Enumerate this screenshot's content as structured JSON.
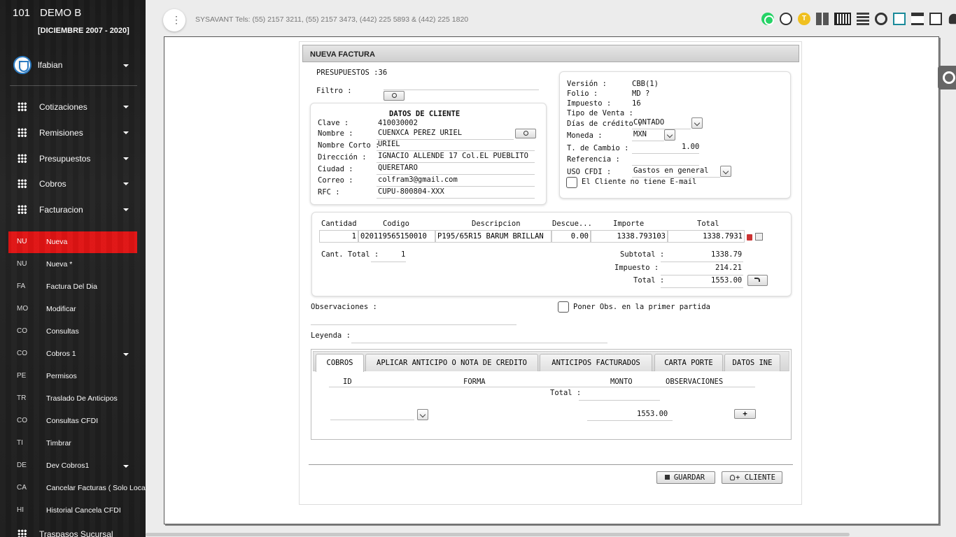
{
  "sidebar": {
    "company_num": "101",
    "company_name": "DEMO B",
    "period": "[DICIEMBRE 2007 - 2020]",
    "username": "lfabian",
    "menus": [
      {
        "label": "Cotizaciones"
      },
      {
        "label": "Remisiones"
      },
      {
        "label": "Presupuestos"
      },
      {
        "label": "Cobros"
      },
      {
        "label": "Facturacion"
      }
    ],
    "items": [
      {
        "abbr": "NU",
        "label": "Nueva"
      },
      {
        "abbr": "NU",
        "label": "Nueva *"
      },
      {
        "abbr": "FA",
        "label": "Factura Del Dia"
      },
      {
        "abbr": "MO",
        "label": "Modificar"
      },
      {
        "abbr": "CO",
        "label": "Consultas"
      },
      {
        "abbr": "CO",
        "label": "Cobros 1"
      },
      {
        "abbr": "PE",
        "label": "Permisos"
      },
      {
        "abbr": "TR",
        "label": "Traslado De Anticipos"
      },
      {
        "abbr": "CO",
        "label": "Consultas CFDI"
      },
      {
        "abbr": "TI",
        "label": "Timbrar"
      },
      {
        "abbr": "DE",
        "label": "Dev Cobros1"
      },
      {
        "abbr": "CA",
        "label": "Cancelar Facturas ( Solo Local"
      },
      {
        "abbr": "HI",
        "label": "Historial Cancela CFDI"
      }
    ],
    "last_menu": "Traspasos Sucursal"
  },
  "topbar": {
    "info": "SYSAVANT Tels: (55) 2157 3211, (55) 2157 3473, (442) 225 5893 & (442) 225 1820",
    "t_icon": "T"
  },
  "form": {
    "title": "NUEVA FACTURA",
    "presupuestos": "PRESUPUESTOS :36",
    "filtro_label": "Filtro :",
    "cliente": {
      "title": "DATOS DE CLIENTE",
      "labels": [
        "Clave :",
        "Nombre :",
        "Nombre Corto :",
        "Dirección :",
        "Ciudad :",
        "Correo :",
        "RFC :"
      ],
      "values": [
        "410030002",
        "CUENXCA PEREZ URIEL",
        "URIEL",
        "IGNACIO ALLENDE 17 Col.EL PUEBLITO",
        "QUERETARO",
        "colfram3@gmail.com",
        "CUPU-800804-XXX"
      ]
    },
    "info": {
      "labels": [
        "Versión :",
        "Folio :",
        "Impuesto :",
        "Tipo de Venta :",
        "Días de crédito :",
        "Moneda :",
        "T. de Cambio :",
        "Referencia :",
        "USO CFDI :"
      ],
      "version": "CBB(1)",
      "folio": "MD ?",
      "impuesto": "16",
      "dias_credito": "CONTADO",
      "moneda": "MXN",
      "tipo_cambio": "1.00",
      "uso_cfdi": "Gastos en general",
      "no_email": "El Cliente no tiene E-mail"
    },
    "items": {
      "headers": [
        "Cantidad",
        "Codigo",
        "Descripcion",
        "Descue...",
        "Importe",
        "Total"
      ],
      "rows": [
        {
          "cantidad": "1",
          "codigo": "020119565150010",
          "descripcion": "P195/65R15 BARUM BRILLAN",
          "descuento": "0.00",
          "importe": "1338.793103",
          "total": "1338.7931"
        }
      ],
      "cant_total_label": "Cant. Total :",
      "cant_total": "1",
      "subtotal_label": "Subtotal :",
      "subtotal": "1338.79",
      "impuesto_label": "Impuesto :",
      "impuesto": "214.21",
      "total_label": "Total :",
      "total": "1553.00"
    },
    "observaciones_label": "Observaciones :",
    "obs_check": "Poner Obs. en la primer partida",
    "leyenda_label": "Leyenda :",
    "tabs": [
      "COBROS",
      "APLICAR ANTICIPO O NOTA DE CREDITO",
      "ANTICIPOS FACTURADOS",
      "CARTA PORTE",
      "DATOS INE"
    ],
    "cobros": {
      "headers": [
        "ID",
        "FORMA",
        "MONTO",
        "OBSERVACIONES"
      ],
      "total_label": "Total :",
      "monto": "1553.00",
      "add": "+"
    },
    "guardar": "GUARDAR",
    "cliente_btn": "+ CLIENTE"
  }
}
